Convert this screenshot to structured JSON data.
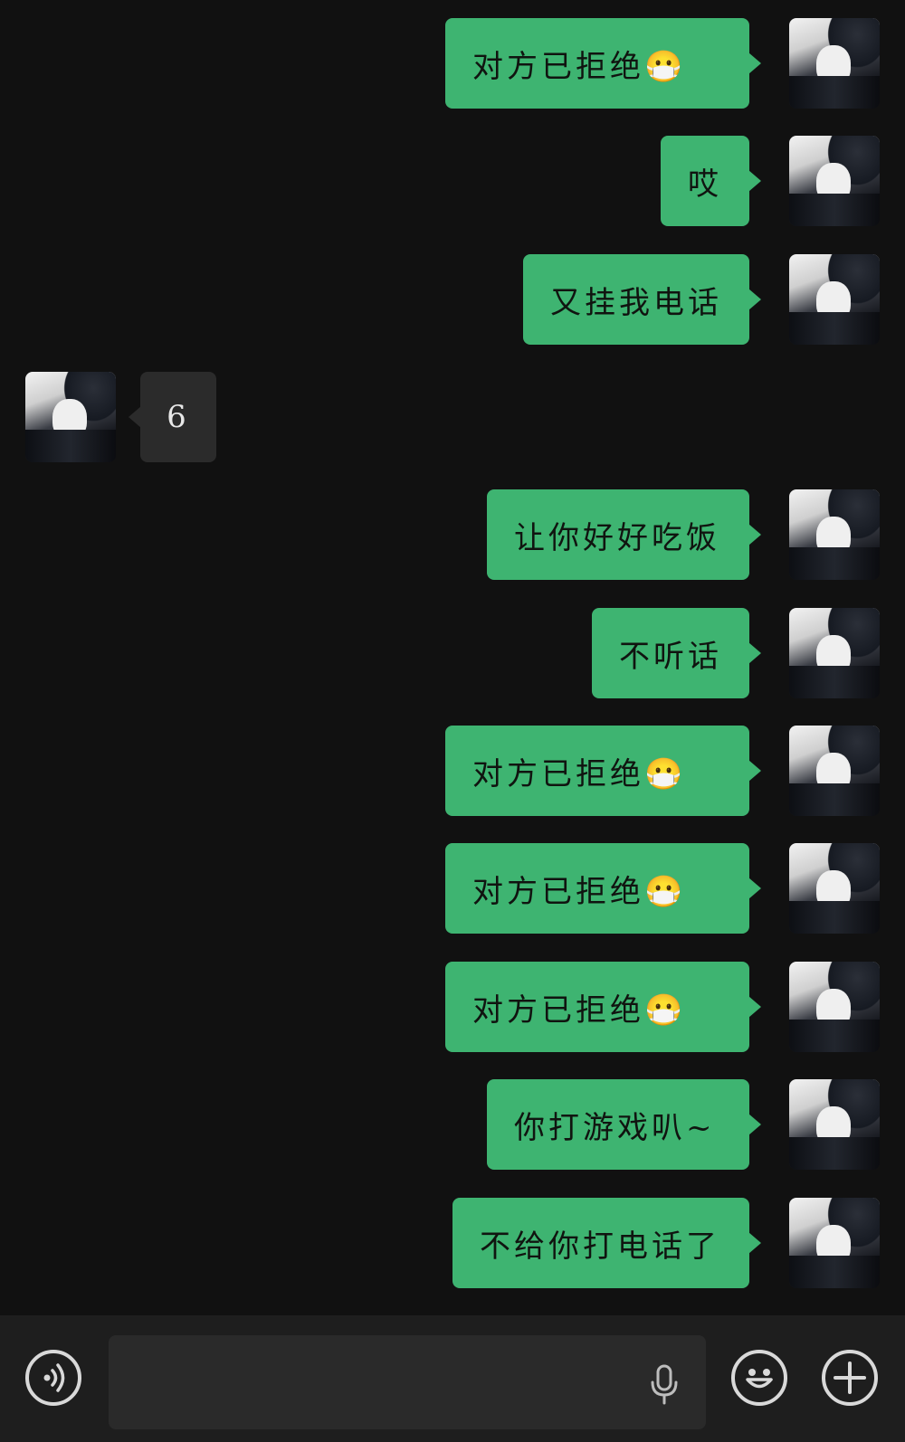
{
  "messages": [
    {
      "side": "out",
      "text": "对方已拒绝😷"
    },
    {
      "side": "out",
      "text": "哎"
    },
    {
      "side": "out",
      "text": "又挂我电话"
    },
    {
      "side": "in",
      "text": "6"
    },
    {
      "side": "out",
      "text": "让你好好吃饭"
    },
    {
      "side": "out",
      "text": "不听话"
    },
    {
      "side": "out",
      "text": "对方已拒绝😷"
    },
    {
      "side": "out",
      "text": "对方已拒绝😷"
    },
    {
      "side": "out",
      "text": "对方已拒绝😷"
    },
    {
      "side": "out",
      "text": "你打游戏叭~"
    },
    {
      "side": "out",
      "text": "不给你打电话了"
    }
  ],
  "input_bar": {
    "voice_icon": "voice-icon",
    "placeholder": "",
    "mic_icon": "microphone-icon",
    "emoji_icon": "emoji-icon",
    "plus_icon": "plus-icon"
  },
  "colors": {
    "background": "#111111",
    "outgoing_bubble": "#3EB471",
    "incoming_bubble": "#2b2b2b",
    "input_bar": "#1e1e1e"
  }
}
